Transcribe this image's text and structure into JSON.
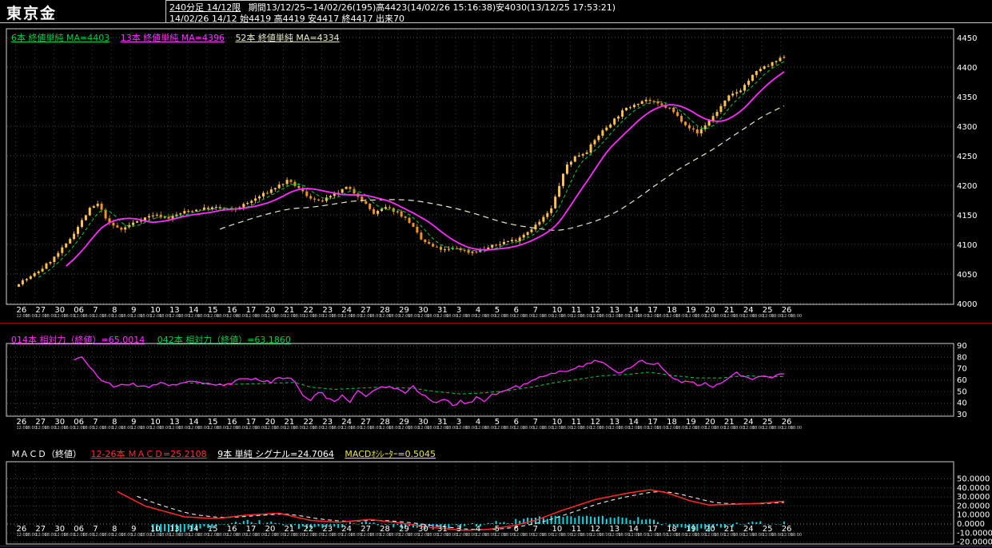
{
  "header": {
    "title": "東京金",
    "timeframe": "240分足 14/12限",
    "period": "期間13/12/25~14/02/26(195)高4423(14/02/26 15:16:38)安4030(13/12/25 17:53:21)",
    "quote": "14/02/26 14/12 始4419 高4419 安4417 終4417 出来70"
  },
  "colors": {
    "background": "#000000",
    "candle_up": "#ffc24f",
    "candle_down": "#ef9420",
    "ma6": "#00cc44",
    "ma13": "#ff2fff",
    "ma52": "#e8e8c8",
    "rsi14": "#ff2fff",
    "rsi42": "#00cc44",
    "macd_line": "#ff2a2a",
    "signal_line": "#f0f0f0",
    "histogram": "#00dde8",
    "separator": "#990000",
    "grid_h": "#474747",
    "grid_v": "#1f4f1f",
    "border": "#d0d0d0"
  },
  "axis": {
    "dates": [
      "26",
      "27",
      "30",
      "06",
      "7",
      "8",
      "9",
      "10",
      "13",
      "14",
      "15",
      "16",
      "17",
      "20",
      "21",
      "22",
      "23",
      "24",
      "27",
      "28",
      "29",
      "30",
      "31",
      "3",
      "4",
      "5",
      "6",
      "7",
      "10",
      "11",
      "12",
      "13",
      "14",
      "17",
      "18",
      "19",
      "20",
      "21",
      "24",
      "25",
      "26"
    ],
    "times": [
      "12:00",
      "18:00"
    ]
  },
  "chart_data": [
    {
      "type": "candlestick",
      "title": "東京金 240分足 14/12限",
      "bars": 195,
      "ylim": [
        4000,
        4450
      ],
      "y_ticks": [
        4450,
        4400,
        4350,
        4300,
        4250,
        4200,
        4150,
        4100,
        4050,
        4000
      ],
      "high": 4423,
      "low": 4030,
      "open": 4419,
      "close": 4417,
      "legend": [
        {
          "label": "6本 終値単純 MA=4403",
          "period": 6,
          "value": 4403
        },
        {
          "label": "13本 終値単純 MA=4396",
          "period": 13,
          "value": 4396
        },
        {
          "label": "52本 終値単純 MA=4334",
          "period": 52,
          "value": 4334
        }
      ],
      "ma_periods": [
        6,
        13,
        52
      ],
      "close_keyframes": [
        [
          0,
          4035
        ],
        [
          3,
          4045
        ],
        [
          6,
          4060
        ],
        [
          9,
          4078
        ],
        [
          12,
          4100
        ],
        [
          15,
          4130
        ],
        [
          18,
          4160
        ],
        [
          20,
          4168
        ],
        [
          23,
          4135
        ],
        [
          26,
          4125
        ],
        [
          30,
          4140
        ],
        [
          34,
          4150
        ],
        [
          38,
          4145
        ],
        [
          42,
          4155
        ],
        [
          46,
          4160
        ],
        [
          50,
          4162
        ],
        [
          54,
          4158
        ],
        [
          58,
          4170
        ],
        [
          62,
          4185
        ],
        [
          66,
          4200
        ],
        [
          68,
          4207
        ],
        [
          70,
          4200
        ],
        [
          73,
          4183
        ],
        [
          76,
          4172
        ],
        [
          79,
          4180
        ],
        [
          83,
          4196
        ],
        [
          86,
          4183
        ],
        [
          90,
          4152
        ],
        [
          93,
          4162
        ],
        [
          96,
          4155
        ],
        [
          99,
          4138
        ],
        [
          102,
          4108
        ],
        [
          105,
          4096
        ],
        [
          108,
          4090
        ],
        [
          111,
          4094
        ],
        [
          114,
          4087
        ],
        [
          117,
          4090
        ],
        [
          120,
          4097
        ],
        [
          123,
          4104
        ],
        [
          126,
          4108
        ],
        [
          129,
          4122
        ],
        [
          132,
          4138
        ],
        [
          135,
          4160
        ],
        [
          137,
          4200
        ],
        [
          139,
          4235
        ],
        [
          141,
          4248
        ],
        [
          144,
          4258
        ],
        [
          147,
          4285
        ],
        [
          150,
          4305
        ],
        [
          153,
          4325
        ],
        [
          156,
          4338
        ],
        [
          159,
          4345
        ],
        [
          162,
          4337
        ],
        [
          165,
          4330
        ],
        [
          168,
          4310
        ],
        [
          170,
          4298
        ],
        [
          172,
          4288
        ],
        [
          174,
          4302
        ],
        [
          177,
          4325
        ],
        [
          180,
          4350
        ],
        [
          183,
          4362
        ],
        [
          186,
          4385
        ],
        [
          188,
          4398
        ],
        [
          190,
          4402
        ],
        [
          192,
          4410
        ],
        [
          194,
          4417
        ]
      ]
    },
    {
      "type": "line",
      "name": "RSI",
      "labels": [
        {
          "text": "014本 相対力（終値）=65.0014",
          "value": 65.0014
        },
        {
          "text": "042本 相対力（終値）=63.1860",
          "value": 63.186
        }
      ],
      "ylim": [
        30,
        90
      ],
      "y_ticks": [
        90,
        80,
        70,
        60,
        50,
        40,
        30
      ],
      "rsi14_keyframes": [
        [
          14,
          78
        ],
        [
          16,
          81
        ],
        [
          20,
          62
        ],
        [
          24,
          55
        ],
        [
          28,
          57
        ],
        [
          32,
          54
        ],
        [
          36,
          58
        ],
        [
          40,
          55
        ],
        [
          44,
          60
        ],
        [
          48,
          57
        ],
        [
          52,
          55
        ],
        [
          56,
          60
        ],
        [
          60,
          62
        ],
        [
          64,
          58
        ],
        [
          66,
          63
        ],
        [
          70,
          60
        ],
        [
          72,
          48
        ],
        [
          74,
          42
        ],
        [
          76,
          50
        ],
        [
          78,
          45
        ],
        [
          80,
          40
        ],
        [
          82,
          48
        ],
        [
          84,
          42
        ],
        [
          86,
          50
        ],
        [
          88,
          46
        ],
        [
          90,
          52
        ],
        [
          94,
          55
        ],
        [
          98,
          50
        ],
        [
          100,
          54
        ],
        [
          102,
          48
        ],
        [
          104,
          44
        ],
        [
          106,
          40
        ],
        [
          108,
          43
        ],
        [
          110,
          38
        ],
        [
          112,
          42
        ],
        [
          114,
          40
        ],
        [
          116,
          45
        ],
        [
          118,
          42
        ],
        [
          120,
          47
        ],
        [
          124,
          52
        ],
        [
          128,
          56
        ],
        [
          132,
          62
        ],
        [
          136,
          66
        ],
        [
          140,
          70
        ],
        [
          144,
          74
        ],
        [
          147,
          77
        ],
        [
          150,
          72
        ],
        [
          152,
          66
        ],
        [
          154,
          70
        ],
        [
          156,
          74
        ],
        [
          158,
          76
        ],
        [
          160,
          73
        ],
        [
          162,
          75
        ],
        [
          164,
          68
        ],
        [
          166,
          62
        ],
        [
          168,
          58
        ],
        [
          170,
          60
        ],
        [
          172,
          55
        ],
        [
          174,
          57
        ],
        [
          176,
          53
        ],
        [
          178,
          58
        ],
        [
          180,
          62
        ],
        [
          182,
          66
        ],
        [
          184,
          63
        ],
        [
          186,
          60
        ],
        [
          188,
          64
        ],
        [
          190,
          62
        ],
        [
          192,
          64
        ],
        [
          194,
          65.0
        ]
      ],
      "rsi42_keyframes": [
        [
          42,
          58
        ],
        [
          50,
          56
        ],
        [
          60,
          57
        ],
        [
          70,
          58
        ],
        [
          74,
          54
        ],
        [
          80,
          52
        ],
        [
          86,
          53
        ],
        [
          92,
          54
        ],
        [
          100,
          53
        ],
        [
          106,
          50
        ],
        [
          112,
          48
        ],
        [
          118,
          49
        ],
        [
          124,
          51
        ],
        [
          130,
          54
        ],
        [
          136,
          58
        ],
        [
          142,
          61
        ],
        [
          148,
          64
        ],
        [
          154,
          65
        ],
        [
          160,
          67
        ],
        [
          166,
          64
        ],
        [
          172,
          62
        ],
        [
          178,
          62
        ],
        [
          184,
          64
        ],
        [
          190,
          63
        ],
        [
          194,
          63.2
        ]
      ]
    },
    {
      "type": "macd",
      "name": "MACD",
      "title": "ＭＡＣＤ（終値）",
      "labels": [
        {
          "text": "12-26本 ＭＡＣＤ=25.2108",
          "value": 25.2108
        },
        {
          "text": "9本 単純 シグナル=24.7064",
          "value": 24.7064
        },
        {
          "text": "MACDｵｼﾚｰﾀｰ=0.5045",
          "value": 0.5045
        }
      ],
      "ylim": [
        -20,
        50
      ],
      "y_ticks": [
        "50.0000",
        "40.0000",
        "30.0000",
        "20.0000",
        "10.0000",
        "0.0000",
        "-10.0000",
        "-20.0000"
      ],
      "signal_period": 9,
      "macd_keyframes": [
        [
          25,
          36
        ],
        [
          32,
          20
        ],
        [
          42,
          8
        ],
        [
          50,
          6
        ],
        [
          58,
          10
        ],
        [
          66,
          12
        ],
        [
          74,
          4
        ],
        [
          81,
          2
        ],
        [
          89,
          5
        ],
        [
          97,
          1
        ],
        [
          105,
          -4
        ],
        [
          113,
          -7
        ],
        [
          119,
          -6
        ],
        [
          125,
          -2
        ],
        [
          131,
          4
        ],
        [
          137,
          14
        ],
        [
          146,
          27
        ],
        [
          154,
          34
        ],
        [
          160,
          38
        ],
        [
          164,
          35
        ],
        [
          170,
          26
        ],
        [
          175,
          21
        ],
        [
          182,
          22
        ],
        [
          188,
          23
        ],
        [
          194,
          25.2
        ]
      ]
    }
  ]
}
